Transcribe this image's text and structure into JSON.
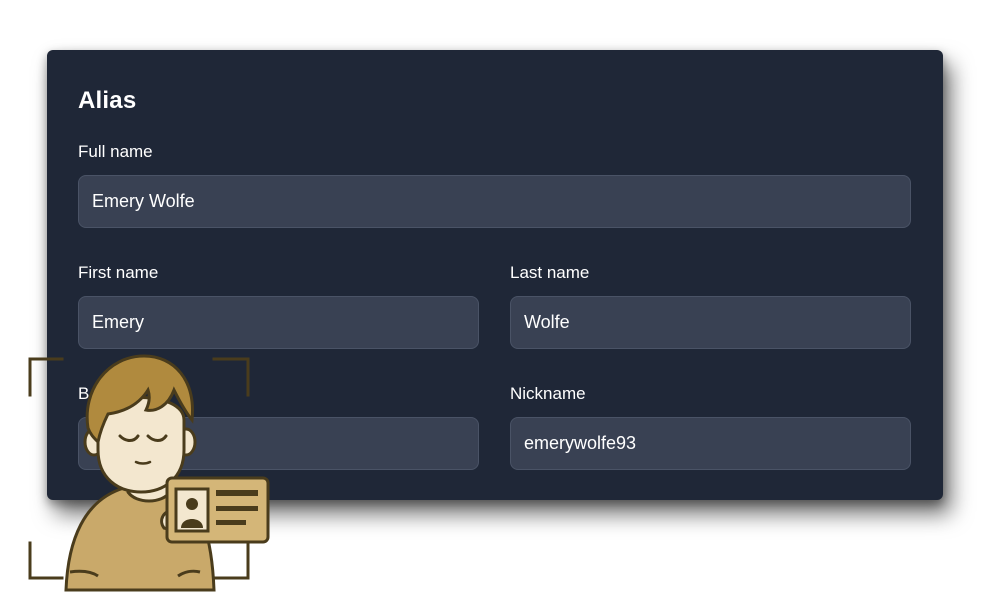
{
  "form": {
    "title": "Alias",
    "full_name": {
      "label": "Full name",
      "value": "Emery Wolfe"
    },
    "first_name": {
      "label": "First name",
      "value": "Emery"
    },
    "last_name": {
      "label": "Last name",
      "value": "Wolfe"
    },
    "birth_name": {
      "label": "B",
      "value": ""
    },
    "nickname": {
      "label": "Nickname",
      "value": "emerywolfe93"
    }
  },
  "colors": {
    "card_bg": "#1f2737",
    "input_bg": "#394153",
    "illustration_accent": "#c9a96a",
    "illustration_outline": "#4a3c1c"
  },
  "illustration": {
    "icon": "person-with-id-card-icon"
  }
}
